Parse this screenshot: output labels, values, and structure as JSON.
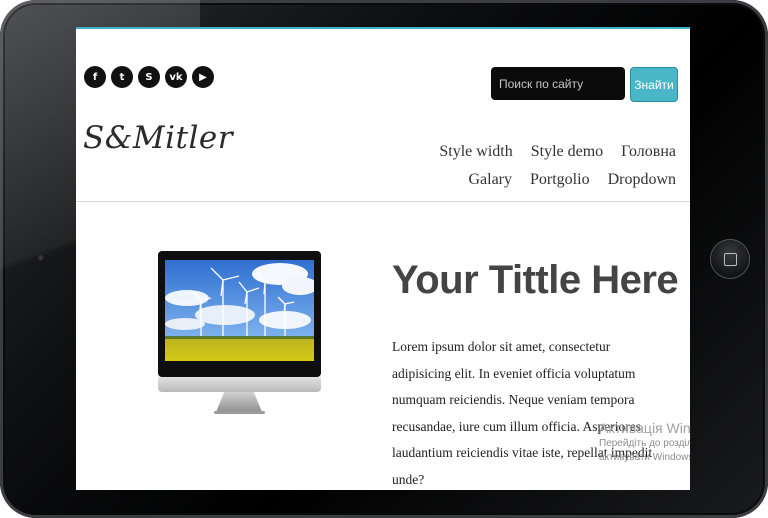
{
  "header": {
    "social_icons": [
      {
        "name": "facebook-icon",
        "glyph": "f"
      },
      {
        "name": "twitter-icon",
        "glyph": "t"
      },
      {
        "name": "skype-icon",
        "glyph": "S"
      },
      {
        "name": "vk-icon",
        "glyph": "vk"
      },
      {
        "name": "youtube-icon",
        "glyph": "▶"
      }
    ],
    "search": {
      "placeholder": "Поиск по сайту",
      "value": ""
    },
    "search_button": "Знайти",
    "logo": "S&Mitler"
  },
  "nav": {
    "row1": [
      "Style width",
      "Style demo",
      "Головна"
    ],
    "row2": [
      "Galary",
      "Portgolio",
      "Dropdown"
    ]
  },
  "hero": {
    "title": "Your Tittle Here",
    "body": "Lorem ipsum dolor sit amet, consectetur adipisicing elit. In eveniet officia voluptatum numquam reiciendis. Neque veniam tempora recusandae, iure cum illum officia. Asperiores laudantium reiciendis vitae iste, repellat impedit unde?"
  },
  "watermark": {
    "title": "Активація Windo",
    "line1": "Перейдіть до розділу",
    "line2": "активувати Windows."
  },
  "colors": {
    "accent": "#4ab7c8",
    "screen_top_border": "#3cb3c6",
    "title_gray": "#444444"
  }
}
